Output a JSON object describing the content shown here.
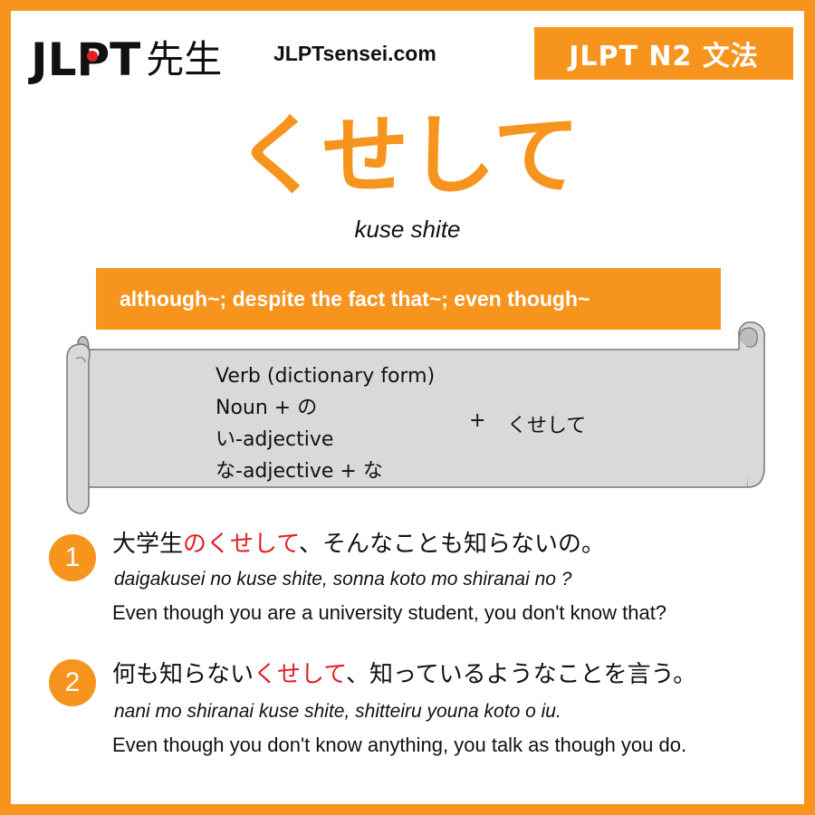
{
  "header": {
    "logo_prefix": "JL",
    "logo_p": "P",
    "logo_t": "T",
    "logo_kanji": "先生",
    "site": "JLPTsensei.com",
    "level_badge": "JLPT N2 文法"
  },
  "grammar": {
    "title": "くせして",
    "romaji": "kuse shite",
    "meaning": "although~; despite the fact that~; even though~"
  },
  "formation": {
    "items": [
      "Verb (dictionary form)",
      "Noun + の",
      "い-adjective",
      "な-adjective + な"
    ],
    "plus": "+",
    "grammar": "くせして"
  },
  "examples": [
    {
      "number": "1",
      "jp_before": "大学生",
      "jp_highlight": "のくせして",
      "jp_after": "、そんなことも知らないの。",
      "romaji": "daigakusei no kuse shite, sonna koto mo shiranai no ?",
      "english": "Even though you are a university student, you don't know that?"
    },
    {
      "number": "2",
      "jp_before": "何も知らない",
      "jp_highlight": "くせして",
      "jp_after": "、知っているようなことを言う。",
      "romaji": "nani mo shiranai kuse shite, shitteiru youna koto o iu.",
      "english": "Even though you don't know anything, you talk as though you do."
    }
  ],
  "colors": {
    "accent": "#f7941d",
    "highlight": "#e41d26",
    "scroll_fill": "#d9d9d9"
  },
  "icons": {
    "scroll": "scroll-banner"
  }
}
